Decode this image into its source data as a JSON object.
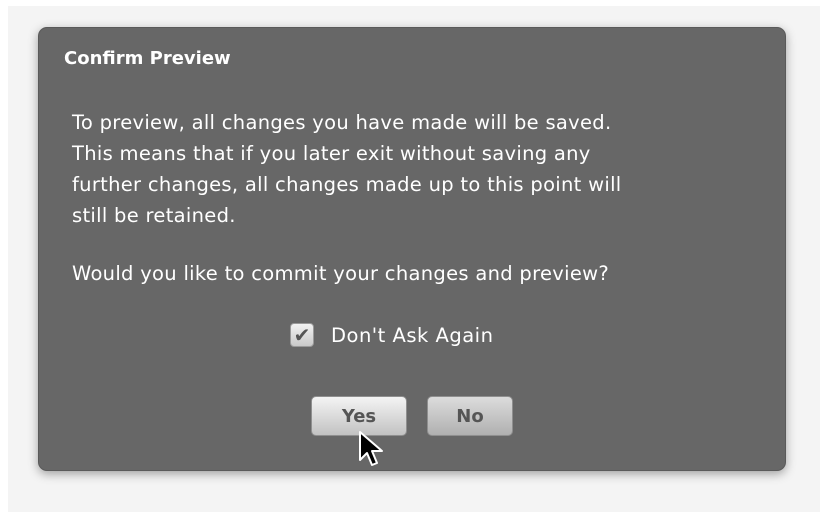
{
  "dialog": {
    "title": "Confirm Preview",
    "message_lines": [
      "To preview, all changes you have made will be saved.",
      "This means that if you later exit without saving any",
      "further changes, all changes made up to this point will",
      "still be retained."
    ],
    "question": "Would you like to commit your changes and preview?",
    "checkbox": {
      "label": "Don't Ask Again",
      "checked": true,
      "check_glyph": "✔"
    },
    "buttons": {
      "yes": "Yes",
      "no": "No"
    }
  },
  "icons": {
    "cursor": "mouse-pointer-icon",
    "check": "checkmark-icon"
  },
  "colors": {
    "dialog_bg": "#676767",
    "text": "#ffffff",
    "button_text": "#555555"
  }
}
